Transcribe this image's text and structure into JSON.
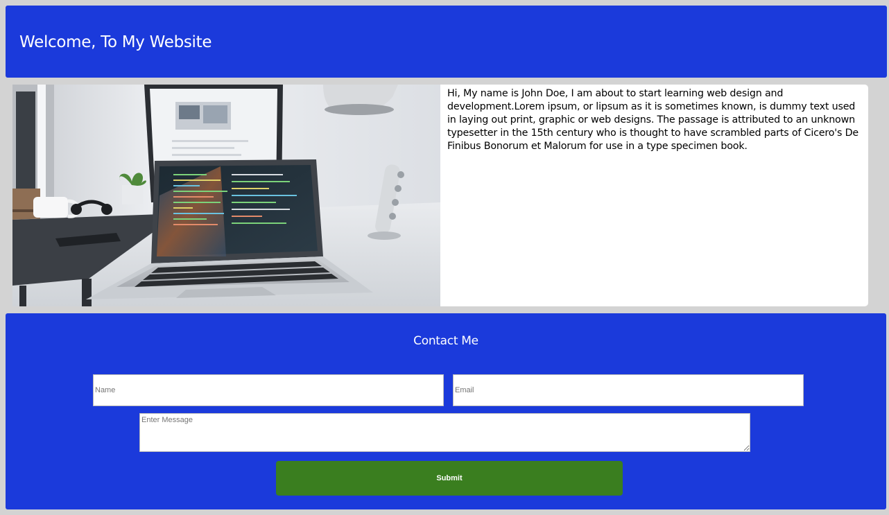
{
  "header": {
    "title": "Welcome, To My Website"
  },
  "about": {
    "image_description": "Laptop with code editor on a white desk next to a monitor, desk lamp and coffee mug",
    "text": "Hi, My name is John Doe, I am about to start learning web design and development.Lorem ipsum, or lipsum as it is sometimes known, is dummy text used in laying out print, graphic or web designs. The passage is attributed to an unknown typesetter in the 15th century who is thought to have scrambled parts of Cicero's De Finibus Bonorum et Malorum for use in a type specimen book."
  },
  "contact": {
    "title": "Contact Me",
    "name_placeholder": "Name",
    "email_placeholder": "Email",
    "message_placeholder": "Enter Message",
    "name_value": "",
    "email_value": "",
    "message_value": "",
    "submit_label": "Submit"
  },
  "colors": {
    "page_background": "#d3d3d3",
    "brand_blue": "#1b3adb",
    "submit_green": "#3a7e1f",
    "text_white": "#ffffff"
  }
}
